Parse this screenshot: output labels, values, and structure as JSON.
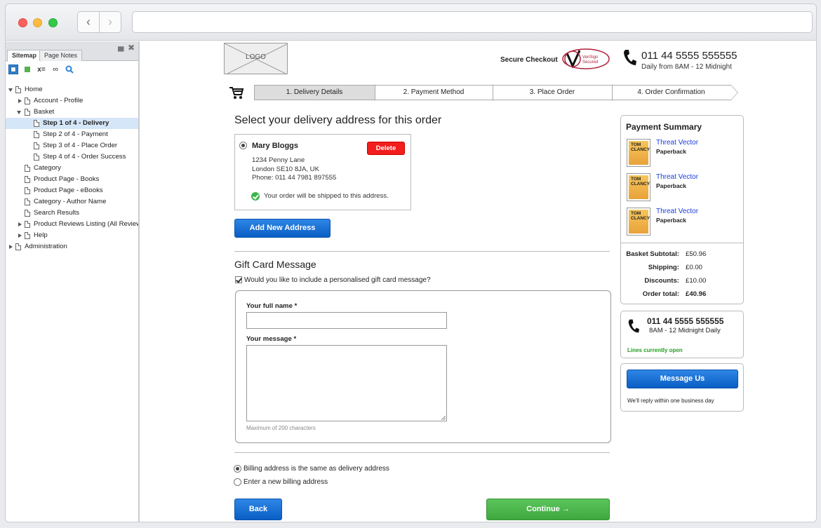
{
  "sidebar": {
    "tabs": [
      "Sitemap",
      "Page Notes"
    ],
    "tree": [
      {
        "label": "Home"
      },
      {
        "label": "Account - Profile"
      },
      {
        "label": "Basket"
      },
      {
        "label": "Step 1 of 4 - Delivery"
      },
      {
        "label": "Step 2 of 4 - Payment"
      },
      {
        "label": "Step 3 of 4 - Place Order"
      },
      {
        "label": "Step 4 of 4 - Order Success"
      },
      {
        "label": "Category"
      },
      {
        "label": "Product Page - Books"
      },
      {
        "label": "Product Page - eBooks"
      },
      {
        "label": "Category - Author Name"
      },
      {
        "label": "Search Results"
      },
      {
        "label": "Product Reviews Listing (All Reviews)"
      },
      {
        "label": "Help"
      },
      {
        "label": "Administration"
      }
    ]
  },
  "header": {
    "logo_text": "LOGO",
    "secure_checkout": "Secure Checkout",
    "phone": "011 44 5555 555555",
    "hours": "Daily from 8AM - 12 Midnight"
  },
  "steps": [
    "1. Delivery Details",
    "2. Payment Method",
    "3. Place Order",
    "4. Order Confirmation"
  ],
  "delivery": {
    "title": "Select your delivery address for this order",
    "name": "Mary Bloggs",
    "lines": [
      "1234 Penny Lane",
      "London SE10 8JA, UK",
      "Phone: 011 44 7981 897555"
    ],
    "delete_label": "Delete",
    "ship_note": "Your order will be shipped to this address.",
    "add_address_label": "Add New Address"
  },
  "gift": {
    "title": "Gift Card Message",
    "checkbox_label": "Would you like to include a personalised gift card message?",
    "name_label": "Your full name *",
    "message_label": "Your message *",
    "hint": "Maximum of 200 characters"
  },
  "billing": {
    "same_label": "Billing address is the same as delivery address",
    "new_label": "Enter a new billing address"
  },
  "actions": {
    "back_label": "Back",
    "continue_label": "Continue →"
  },
  "summary": {
    "title": "Payment Summary",
    "items": [
      {
        "title": "Threat Vector",
        "format": "Paperback",
        "cover": "TOM CLANCY"
      },
      {
        "title": "Threat Vector",
        "format": "Paperback",
        "cover": "TOM CLANCY"
      },
      {
        "title": "Threat Vector",
        "format": "Paperback",
        "cover": "TOM CLANCY"
      }
    ],
    "totals": [
      {
        "label": "Basket Subtotal:",
        "value": "£50.96"
      },
      {
        "label": "Shipping:",
        "value": "£0.00"
      },
      {
        "label": "Discounts:",
        "value": "£10.00"
      },
      {
        "label": "Order total:",
        "value": "£40.96"
      }
    ]
  },
  "contact": {
    "phone": "011 44 5555 555555",
    "hours": "8AM - 12 Midnight Daily",
    "status": "Lines currently open",
    "status_color": "#22a022",
    "message_label": "Message Us",
    "reply_note": "We'll reply within one business day"
  }
}
